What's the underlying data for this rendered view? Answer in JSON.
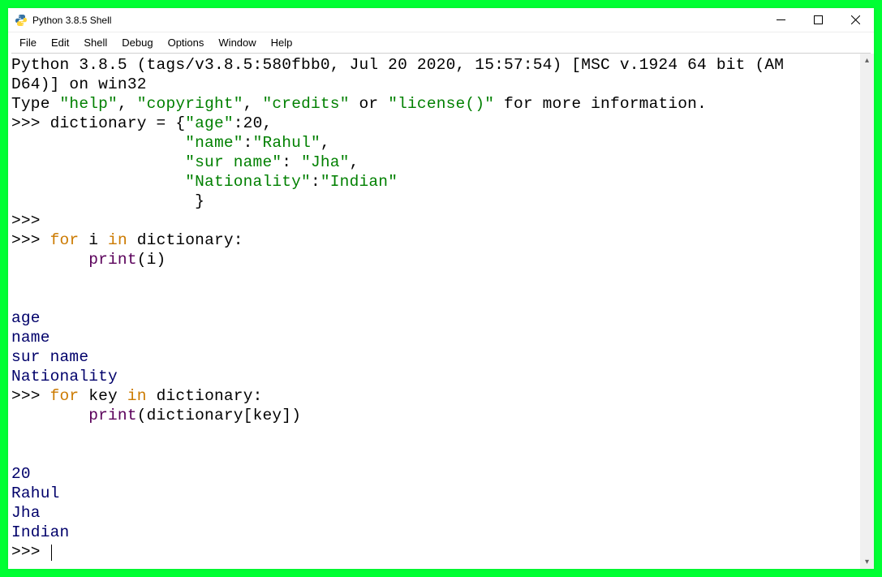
{
  "window": {
    "title": "Python 3.8.5 Shell"
  },
  "menu": {
    "items": [
      "File",
      "Edit",
      "Shell",
      "Debug",
      "Options",
      "Window",
      "Help"
    ]
  },
  "shell": {
    "banner1": "Python 3.8.5 (tags/v3.8.5:580fbb0, Jul 20 2020, 15:57:54) [MSC v.1924 64 bit (AM",
    "banner2": "D64)] on win32",
    "banner3a": "Type ",
    "banner3b": "\"help\"",
    "banner3c": ", ",
    "banner3d": "\"copyright\"",
    "banner3e": ", ",
    "banner3f": "\"credits\"",
    "banner3g": " or ",
    "banner3h": "\"license()\"",
    "banner3i": " for more information.",
    "p": ">>> ",
    "pempty": ">>>",
    "indent8": "        ",
    "indent18": "                  ",
    "indent19": "                   ",
    "dict_assign": "dictionary = {",
    "k_age": "\"age\"",
    "colon": ":",
    "v_age": "20",
    "comma": ",",
    "k_name": "\"name\"",
    "v_name": "\"Rahul\"",
    "k_sur": "\"sur name\"",
    "colon_sp": ": ",
    "v_sur": "\"Jha\"",
    "k_nat": "\"Nationality\"",
    "v_nat": "\"Indian\"",
    "close_brace": "}",
    "kw_for": "for",
    "kw_in": "in",
    "sp": " ",
    "var_i": "i",
    "var_key": "key",
    "var_dict": "dictionary",
    "colon_end": ":",
    "bi_print": "print",
    "lp": "(",
    "rp": ")",
    "lb": "[",
    "rb": "]",
    "out1": "age",
    "out2": "name",
    "out3": "sur name",
    "out4": "Nationality",
    "out5": "20",
    "out6": "Rahul",
    "out7": "Jha",
    "out8": "Indian"
  }
}
